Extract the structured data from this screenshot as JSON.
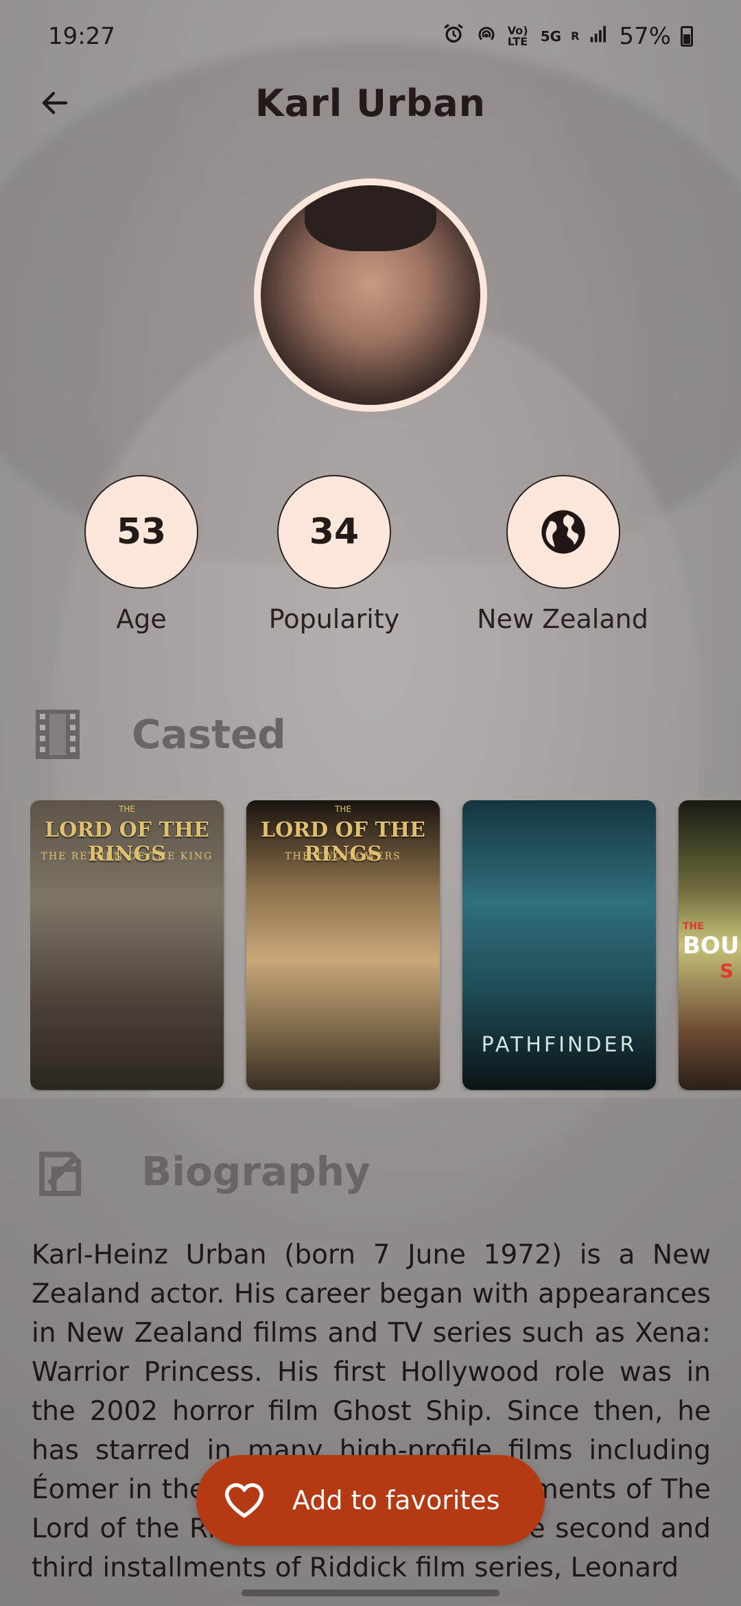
{
  "status_bar": {
    "time": "19:27",
    "battery": "57%",
    "icons": [
      "alarm-icon",
      "hotspot-icon",
      "volte-icon",
      "5g-icon",
      "signal-icon",
      "battery-icon"
    ],
    "volte": "Vo) LTE",
    "network": "5G",
    "roaming": "R"
  },
  "app_bar": {
    "title": "Karl Urban",
    "back_icon": "arrow-left-icon"
  },
  "stats": {
    "age_value": "53",
    "age_label": "Age",
    "popularity_value": "34",
    "popularity_label": "Popularity",
    "country_icon": "globe-icon",
    "country_label": "New Zealand"
  },
  "casted": {
    "title": "Casted",
    "icon": "film-strip-icon",
    "posters": [
      {
        "title": "LORD OF THE RINGS",
        "subtitle": "THE RETURN OF THE KING",
        "top": "THE"
      },
      {
        "title": "LORD OF THE RINGS",
        "subtitle": "THE TWO TOWERS",
        "top": "THE"
      },
      {
        "title": "PATHFINDER"
      },
      {
        "title": "BOU",
        "top": "THE",
        "extra": "S"
      }
    ]
  },
  "biography": {
    "title": "Biography",
    "icon": "biography-icon",
    "text": "Karl-Heinz Urban (born 7 June 1972) is a New Zealand actor. His career began with appearances in New Zealand films and TV series such as Xena: Warrior Princess. His first Hollywood role was in the 2002 horror film Ghost Ship. Since then, he has starred in many high-profile films including Éomer in the second and third installments of The Lord of the Rings trilogy, Vaako in the second and third installments of Riddick film series, Leonard"
  },
  "fab": {
    "label": "Add to favorites",
    "icon": "heart-outline-icon"
  },
  "colors": {
    "accent": "#b33a13",
    "circle_fill": "#fde6dc",
    "text_dark": "#1e1716",
    "section_gray": "#6a6463"
  }
}
